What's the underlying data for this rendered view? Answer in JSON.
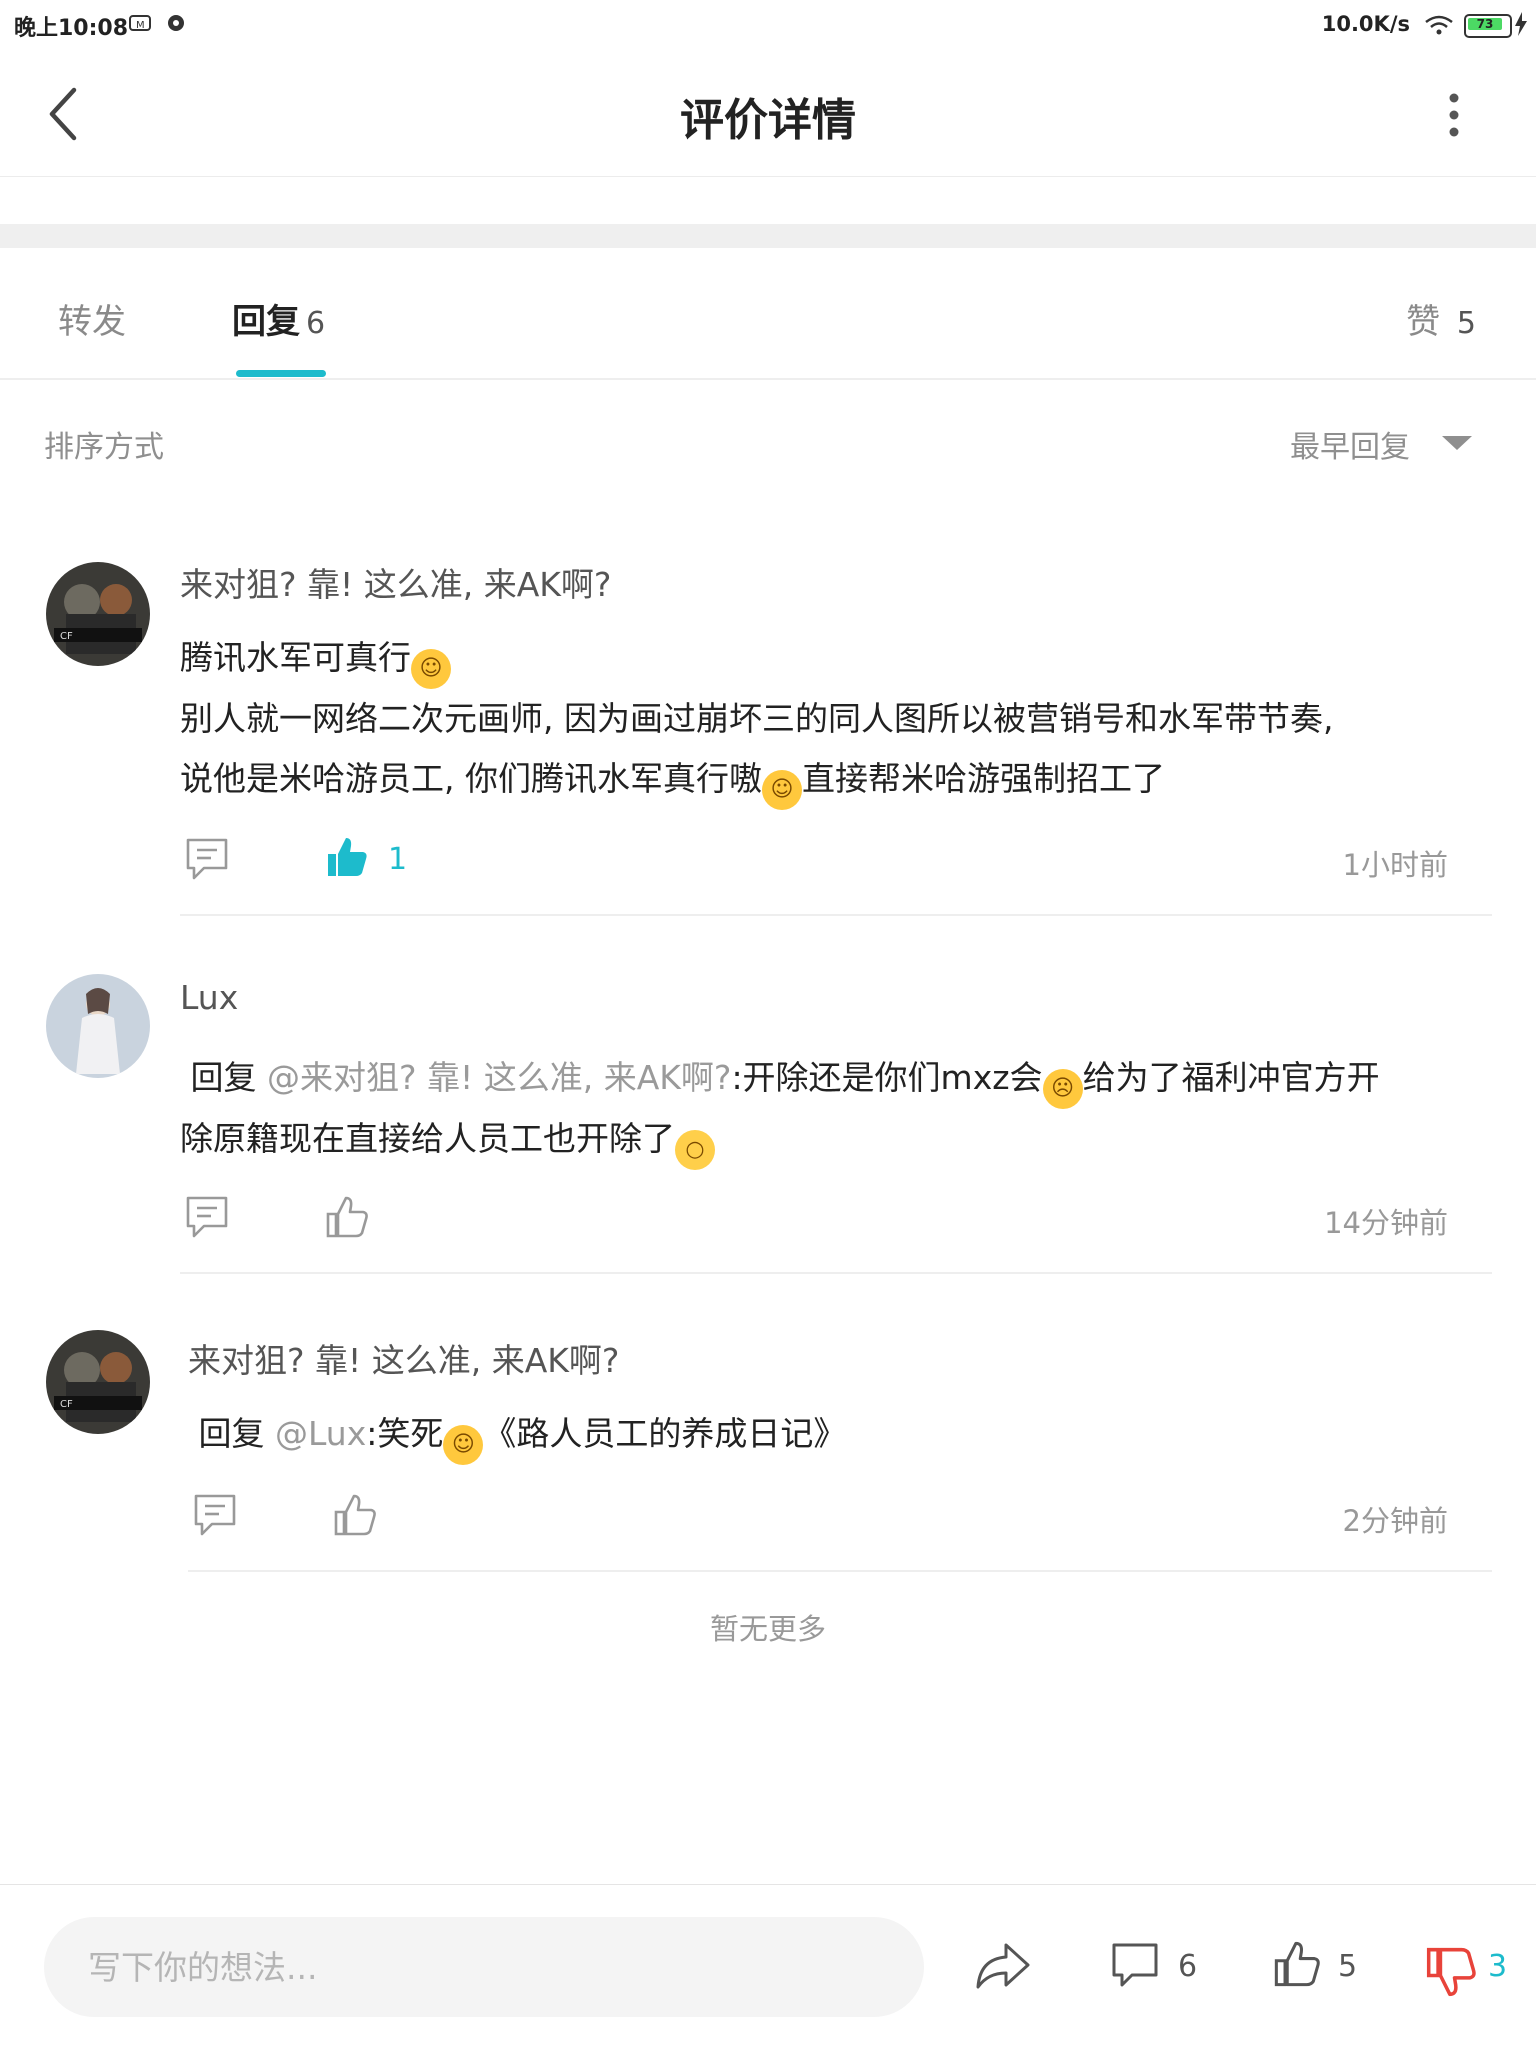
{
  "status_bar": {
    "time": "晚上10:08",
    "net_speed": "10.0K/s",
    "battery": "73"
  },
  "header": {
    "title": "评价详情"
  },
  "tabs": {
    "forward": {
      "label": "转发"
    },
    "reply": {
      "label": "回复",
      "count": "6"
    },
    "like": {
      "label": "赞",
      "count": "5"
    }
  },
  "sort": {
    "label": "排序方式",
    "value": "最早回复"
  },
  "comments": [
    {
      "user": "来对狙? 靠! 这么准, 来AK啊?",
      "line1": "腾讯水军可真行",
      "line2": "别人就一网络二次元画师, 因为画过崩坏三的同人图所以被营销号和水军带节奏,",
      "line3a": "说他是米哈游员工, 你们腾讯水军真行嗷",
      "line3b": "直接帮米哈游强制招工了",
      "likes": "1",
      "time": "1小时前"
    },
    {
      "user": "Lux",
      "reply_prefix": "回复",
      "mention": "@来对狙? 靠! 这么准, 来AK啊?",
      "text_a": ":开除还是你们mxz会",
      "text_b": "给为了福利冲官方开",
      "text_c": "除原籍现在直接给人员工也开除了",
      "time": "14分钟前"
    },
    {
      "user": "来对狙? 靠! 这么准, 来AK啊?",
      "reply_prefix": "回复",
      "mention": "@Lux",
      "text_a": ":笑死",
      "text_b": "《路人员工的养成日记》",
      "time": "2分钟前"
    }
  ],
  "footer_note": "暂无更多",
  "bottom_bar": {
    "input_placeholder": "写下你的想法...",
    "comments": "6",
    "likes": "5",
    "dislikes": "3"
  },
  "colors": {
    "accent": "#1dbbcc",
    "dislike": "#e8433a"
  },
  "icons": [
    "back-arrow-icon",
    "more-vertical-icon",
    "comment-icon",
    "thumb-up-icon",
    "share-icon",
    "thumb-down-icon",
    "wifi-icon",
    "battery-icon"
  ]
}
